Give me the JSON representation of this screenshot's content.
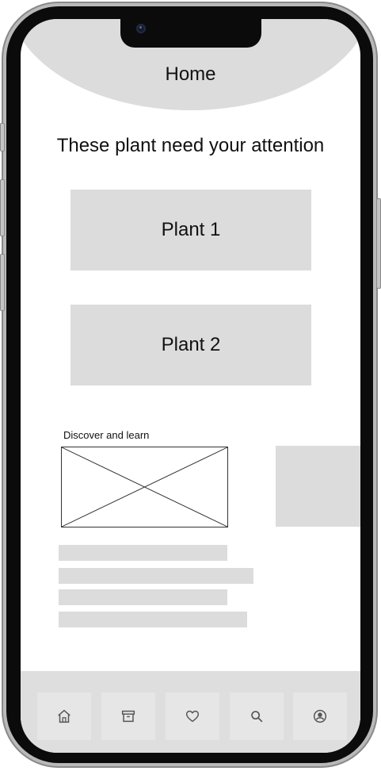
{
  "header": {
    "title": "Home"
  },
  "attention": {
    "heading": "These plant need your attention"
  },
  "plants": [
    {
      "label": "Plant 1"
    },
    {
      "label": "Plant 2"
    }
  ],
  "discover": {
    "label": "Discover and learn"
  },
  "tabs": [
    {
      "icon": "home-icon"
    },
    {
      "icon": "archive-icon"
    },
    {
      "icon": "heart-icon"
    },
    {
      "icon": "search-icon"
    },
    {
      "icon": "profile-icon"
    }
  ],
  "colors": {
    "placeholder": "#dcdcdc",
    "frame": "#0b0b0b",
    "icon": "#555555"
  }
}
